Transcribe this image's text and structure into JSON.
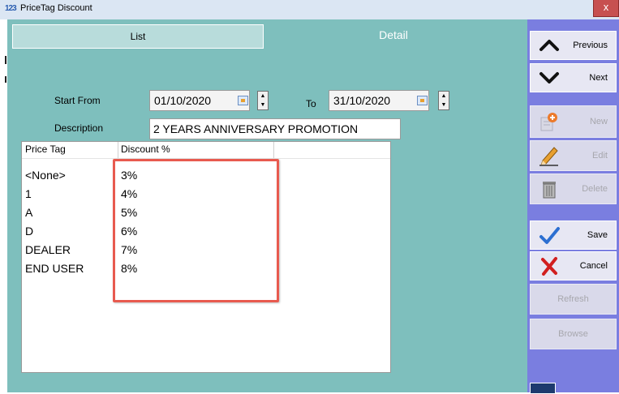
{
  "window": {
    "app_icon": "123",
    "title": "PriceTag Discount",
    "close_label": "x"
  },
  "tabs": {
    "list": "List",
    "detail": "Detail"
  },
  "form": {
    "start_from_label": "Start From",
    "start_from_value": "01/10/2020",
    "to_label": "To",
    "to_value": "31/10/2020",
    "description_label": "Description",
    "description_value": "2 YEARS ANNIVERSARY PROMOTION"
  },
  "grid": {
    "columns": [
      "Price Tag",
      "Discount %"
    ],
    "rows": [
      {
        "price_tag": "<None>",
        "discount": "3%"
      },
      {
        "price_tag": "1",
        "discount": "4%"
      },
      {
        "price_tag": "A",
        "discount": "5%"
      },
      {
        "price_tag": "D",
        "discount": "6%"
      },
      {
        "price_tag": "DEALER",
        "discount": "7%"
      },
      {
        "price_tag": "END USER",
        "discount": "8%"
      }
    ]
  },
  "sidebar": {
    "previous": "Previous",
    "next": "Next",
    "new": "New",
    "edit": "Edit",
    "delete": "Delete",
    "save": "Save",
    "cancel": "Cancel",
    "refresh": "Refresh",
    "browse": "Browse"
  },
  "icons": {
    "previous": "chevron-up-icon",
    "next": "chevron-down-icon",
    "new": "new-document-icon",
    "edit": "pencil-icon",
    "delete": "trash-icon",
    "save": "checkmark-icon",
    "cancel": "x-mark-icon",
    "calendar": "calendar-icon"
  },
  "colors": {
    "panel": "#7ebfbd",
    "sidebar": "#7a7ee0",
    "highlight": "#e85a4f",
    "save_check": "#2c6fd1",
    "cancel_x": "#d11f1f"
  }
}
